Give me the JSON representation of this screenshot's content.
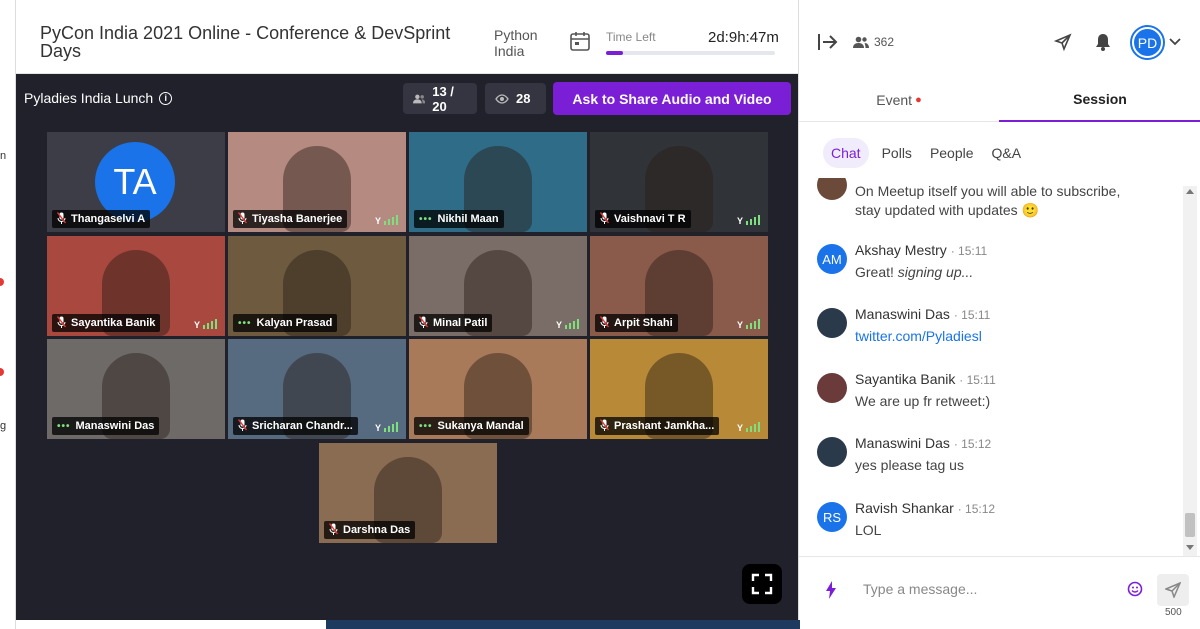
{
  "header": {
    "title": "PyCon India 2021 Online - Conference & DevSprint Days",
    "track_line1": "Python",
    "track_line2": "India",
    "time_left_label": "Time Left",
    "time_left_value": "2d:9h:47m",
    "time_progress": 0.1
  },
  "left_strip": {
    "char_1": "n",
    "char_2": "g"
  },
  "stage": {
    "title": "Pyladies India Lunch",
    "participants": "13 / 20",
    "viewers": "28",
    "ask_button": "Ask to Share Audio and Video"
  },
  "tiles": [
    {
      "name": "Thangaselvi A",
      "initials": "TA",
      "mic": "muted",
      "signal": false,
      "bg": "#3c3d46"
    },
    {
      "name": "Tiyasha Banerjee",
      "mic": "muted",
      "signal": true,
      "bg": "#b58a80"
    },
    {
      "name": "Nikhil Maan",
      "mic": "speaking",
      "signal": false,
      "bg": "#2f6c88"
    },
    {
      "name": "Vaishnavi T R",
      "mic": "muted",
      "signal": true,
      "bg": "#303338"
    },
    {
      "name": "Sayantika Banik",
      "mic": "muted",
      "signal": true,
      "bg": "#a8483f"
    },
    {
      "name": "Kalyan Prasad",
      "mic": "speaking",
      "signal": false,
      "bg": "#6e5a3e"
    },
    {
      "name": "Minal Patil",
      "mic": "muted",
      "signal": true,
      "bg": "#7a6c66"
    },
    {
      "name": "Arpit Shahi",
      "mic": "muted",
      "signal": true,
      "bg": "#8a5a4a"
    },
    {
      "name": "Manaswini Das",
      "mic": "speaking",
      "signal": false,
      "bg": "#6d6a68"
    },
    {
      "name": "Sricharan Chandr...",
      "mic": "muted",
      "signal": true,
      "bg": "#566a80"
    },
    {
      "name": "Sukanya Mandal",
      "mic": "speaking",
      "signal": false,
      "bg": "#a97a5a"
    },
    {
      "name": "Prashant Jamkha...",
      "mic": "muted",
      "signal": true,
      "bg": "#b88a38"
    },
    {
      "name": "Darshna Das",
      "mic": "muted",
      "signal": false,
      "bg": "#8a6c52"
    }
  ],
  "sidebar": {
    "attendees": "362",
    "avatar_initials": "PD",
    "tabs": {
      "event": "Event",
      "session": "Session"
    },
    "subtabs": {
      "chat": "Chat",
      "polls": "Polls",
      "people": "People",
      "qa": "Q&A"
    },
    "messages": [
      {
        "body": "On Meetup itself you will able to subscribe,",
        "body2": "stay updated with updates 🙂"
      },
      {
        "initials": "AM",
        "name": "Akshay Mestry",
        "time": "· 15:11",
        "body": "Great! ",
        "body_em": "signing up...",
        "color": "#1a73e8"
      },
      {
        "name": "Manaswini Das",
        "time": "· 15:11",
        "body": "twitter.com/Pyladiesl",
        "color": "#2a3a4a"
      },
      {
        "name": "Sayantika Banik",
        "time": "· 15:11",
        "body": "We are up fr retweet:)",
        "color": "#6b3a3a"
      },
      {
        "name": "Manaswini Das",
        "time": "· 15:12",
        "body": "yes please tag us",
        "color": "#2a3a4a"
      },
      {
        "initials": "RS",
        "name": "Ravish Shankar",
        "time": "· 15:12",
        "body": "LOL",
        "color": "#1a73e8"
      }
    ],
    "composer_placeholder": "Type a message...",
    "char_count": "500"
  },
  "colors": {
    "accent": "#7b1fd6",
    "stage_bg": "#20212b",
    "avatar_blue": "#1a73e8"
  }
}
